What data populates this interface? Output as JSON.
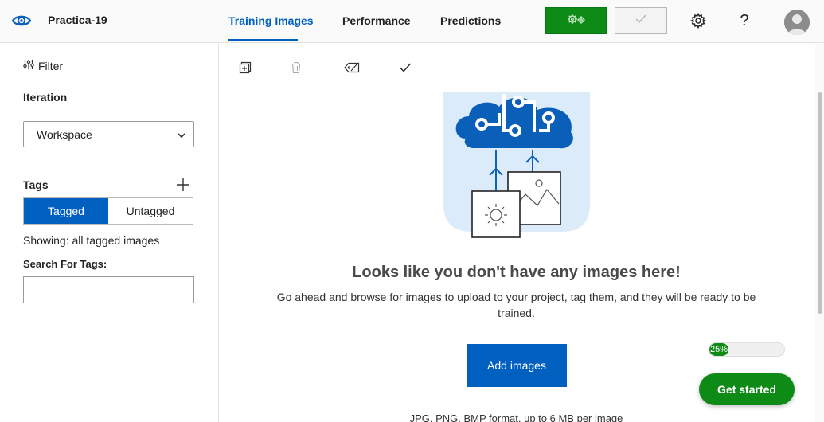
{
  "header": {
    "project_name": "Practica-19",
    "tabs": [
      {
        "label": "Training Images",
        "active": true
      },
      {
        "label": "Performance",
        "active": false
      },
      {
        "label": "Predictions",
        "active": false
      }
    ],
    "train_icon": "gears-icon",
    "quick_test_icon": "checkmark-icon",
    "settings_icon": "gear-icon",
    "help_label": "?"
  },
  "sidebar": {
    "filter_label": "Filter",
    "iteration_title": "Iteration",
    "iteration_selected": "Workspace",
    "tags_title": "Tags",
    "tagged_label": "Tagged",
    "untagged_label": "Untagged",
    "showing_text": "Showing: all tagged images",
    "search_label": "Search For Tags:",
    "search_value": ""
  },
  "toolbar": {
    "icons": [
      "add-images-icon",
      "trash-icon",
      "tag-icon",
      "check-icon"
    ]
  },
  "main": {
    "empty_title": "Looks like you don't have any images here!",
    "empty_desc": "Go ahead and browse for images to upload to your project, tag them, and they will be ready to be trained.",
    "add_images_label": "Add images",
    "formats_text": "JPG, PNG, BMP format, up to 6 MB per image"
  },
  "onboarding": {
    "progress_percent": 25,
    "progress_label": "25%",
    "get_started_label": "Get started"
  },
  "colors": {
    "accent_blue": "#0060c0",
    "green": "#0e8a16",
    "illustration_bg": "#dcebfa",
    "cloud_blue": "#0a5fb8"
  }
}
